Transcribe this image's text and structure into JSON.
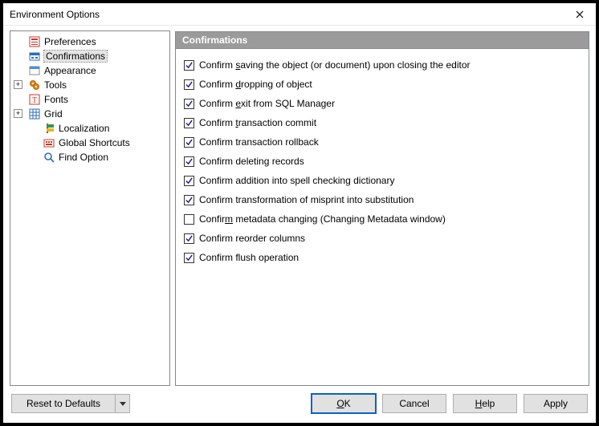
{
  "window": {
    "title": "Environment Options"
  },
  "tree": {
    "preferences": "Preferences",
    "confirmations": "Confirmations",
    "appearance": "Appearance",
    "tools": "Tools",
    "fonts": "Fonts",
    "grid": "Grid",
    "localization": "Localization",
    "global_shortcuts": "Global Shortcuts",
    "find_option": "Find Option"
  },
  "section": {
    "title": "Confirmations"
  },
  "checks": [
    {
      "label": "Confirm saving the object (or document) upon closing the editor",
      "checked": true,
      "mn": "s"
    },
    {
      "label": "Confirm dropping of object",
      "checked": true,
      "mn": "d"
    },
    {
      "label": "Confirm exit from SQL Manager",
      "checked": true,
      "mn": "e"
    },
    {
      "label": "Confirm transaction commit",
      "checked": true,
      "mn": "t"
    },
    {
      "label": "Confirm transaction rollback",
      "checked": true,
      "mn": ""
    },
    {
      "label": "Confirm deleting records",
      "checked": true,
      "mn": ""
    },
    {
      "label": "Confirm addition into spell checking dictionary",
      "checked": true,
      "mn": ""
    },
    {
      "label": "Confirm transformation of misprint into substitution",
      "checked": true,
      "mn": ""
    },
    {
      "label": "Confirm metadata changing (Changing Metadata window)",
      "checked": false,
      "mn": "m"
    },
    {
      "label": "Confirm reorder columns",
      "checked": true,
      "mn": ""
    },
    {
      "label": "Confirm flush operation",
      "checked": true,
      "mn": ""
    }
  ],
  "buttons": {
    "reset": "Reset to Defaults",
    "ok": "OK",
    "cancel": "Cancel",
    "help": "Help",
    "apply": "Apply"
  }
}
